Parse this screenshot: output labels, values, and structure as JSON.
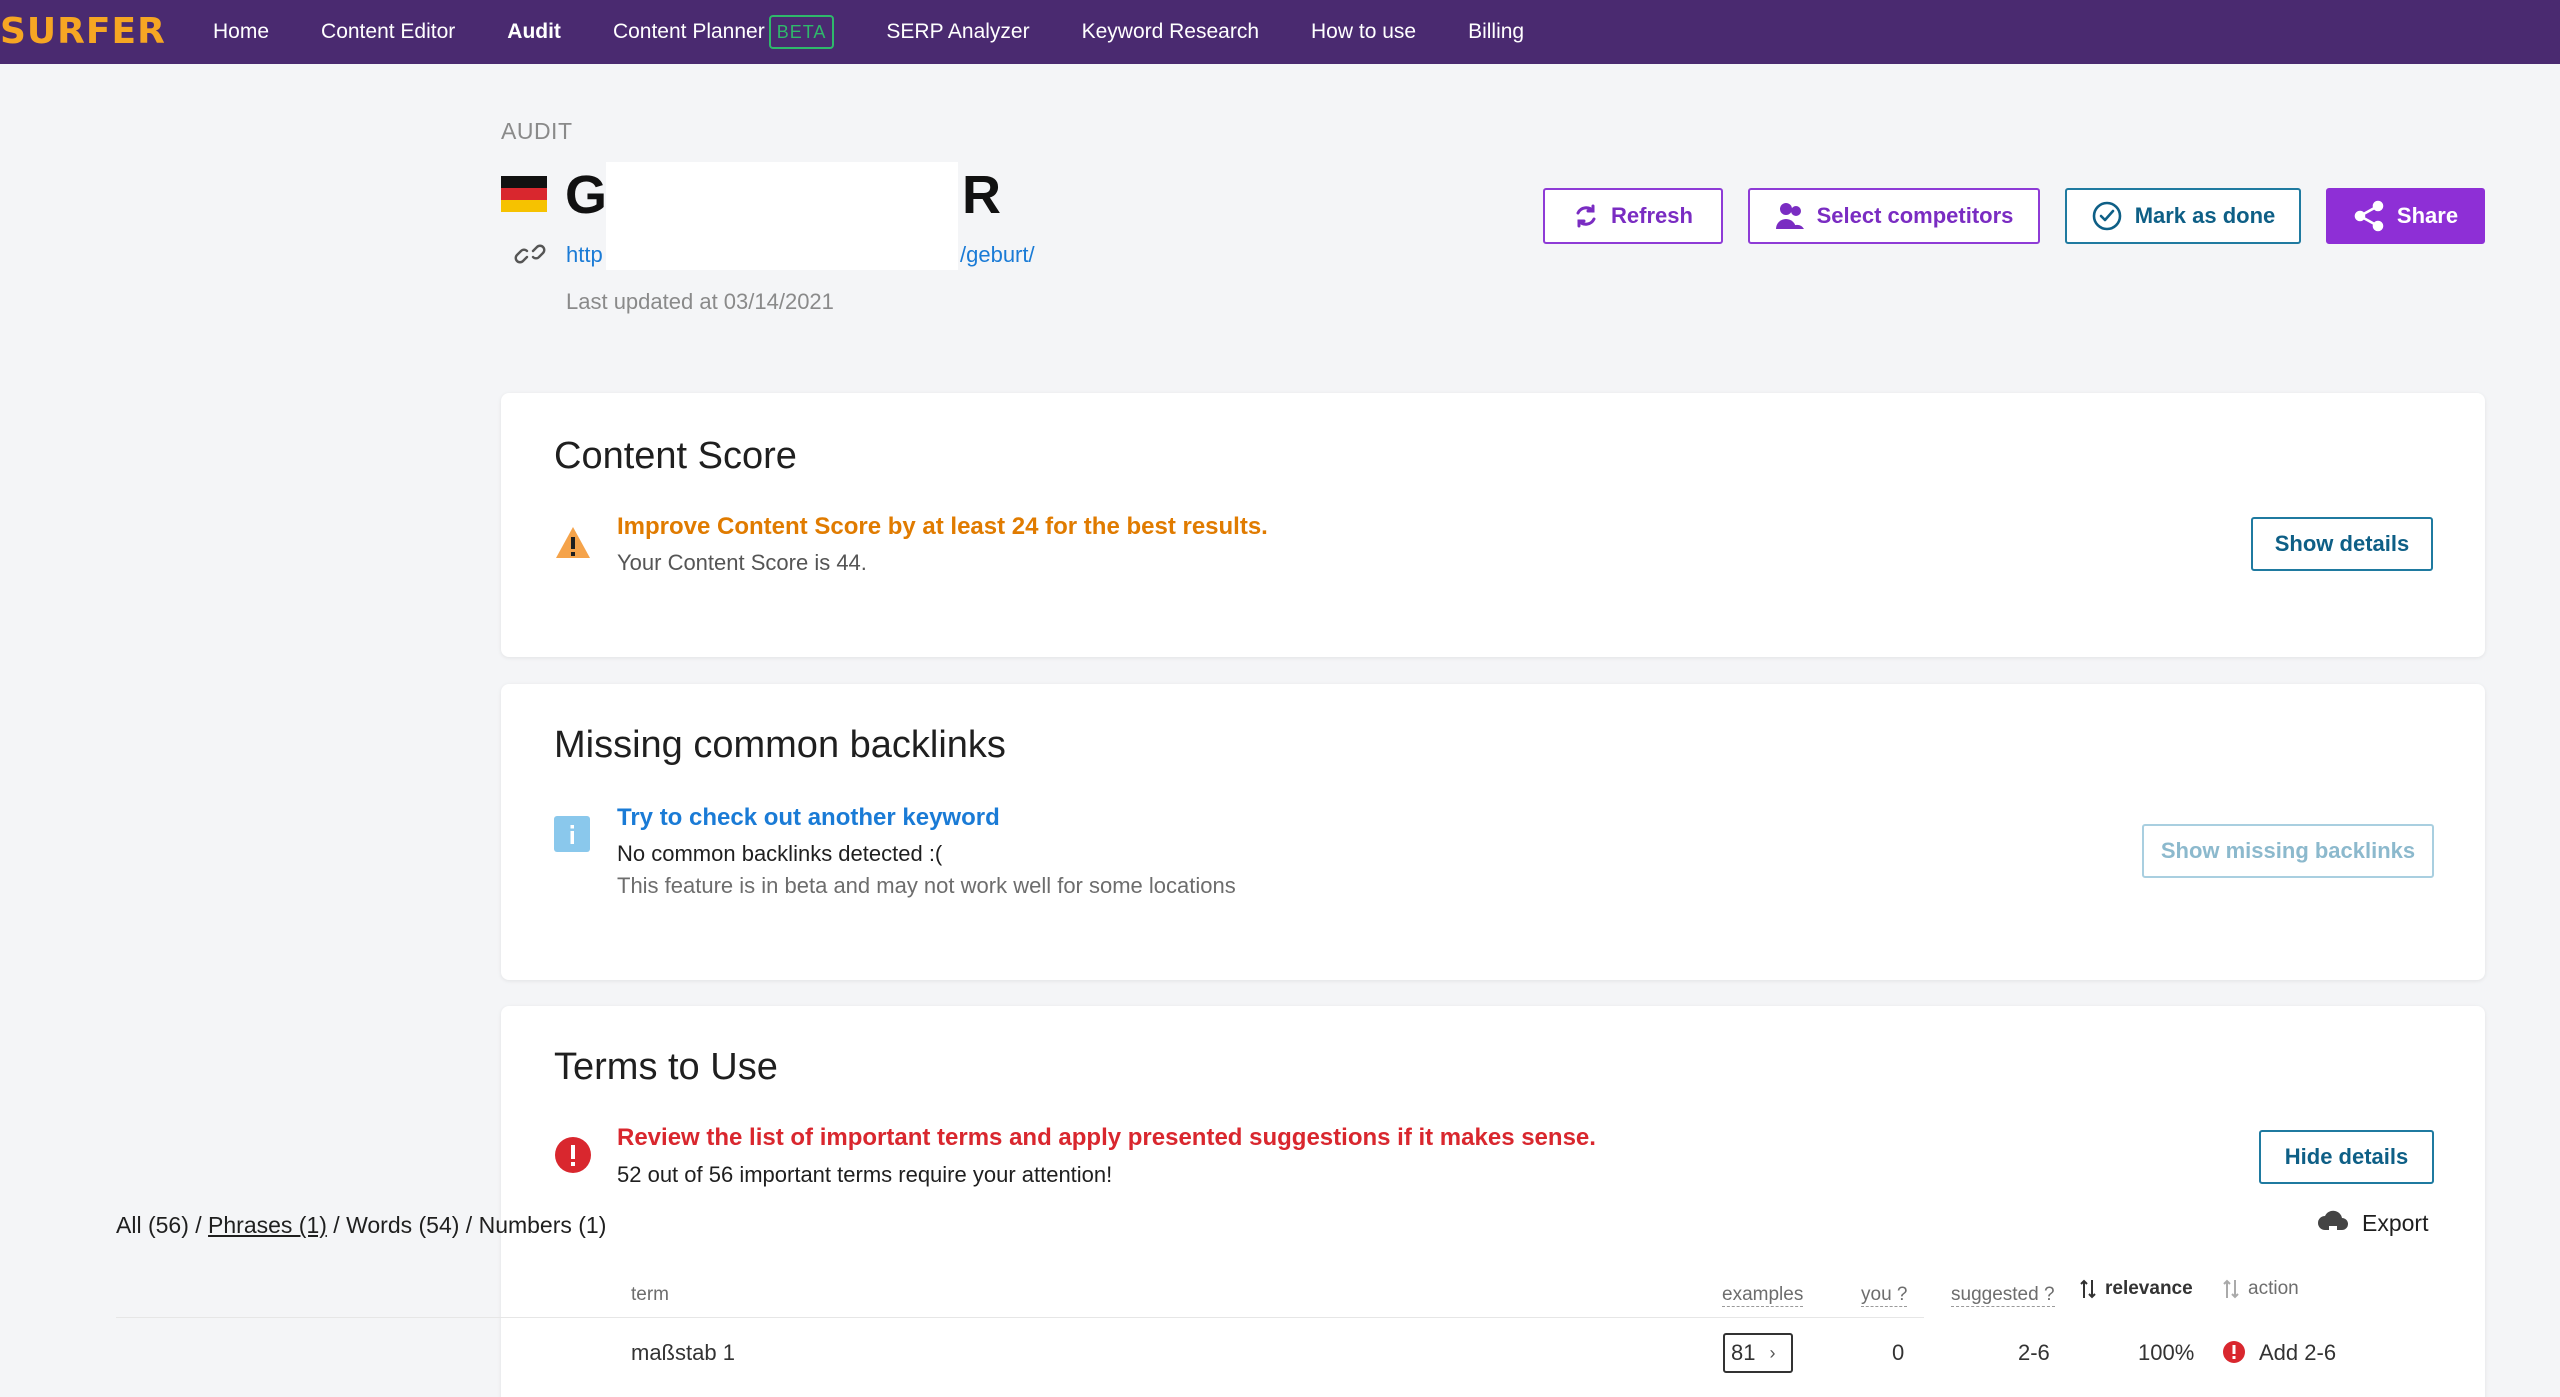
{
  "nav": {
    "logo": "SURFER",
    "items": [
      {
        "label": "Home"
      },
      {
        "label": "Content Editor"
      },
      {
        "label": "Audit"
      },
      {
        "label": "Content Planner",
        "badge": "BETA"
      },
      {
        "label": "SERP Analyzer"
      },
      {
        "label": "Keyword Research"
      },
      {
        "label": "How to use"
      },
      {
        "label": "Billing"
      }
    ]
  },
  "header": {
    "breadcrumb": "AUDIT",
    "title_start": "G",
    "title_end": "R",
    "url_start": "http",
    "url_end": "/geburt/",
    "last_updated": "Last updated at 03/14/2021",
    "buttons": {
      "refresh": "Refresh",
      "select_competitors": "Select competitors",
      "mark_done": "Mark as done",
      "share": "Share"
    }
  },
  "content_score": {
    "title": "Content Score",
    "headline": "Improve Content Score by at least 24 for the best results.",
    "subline": "Your Content Score is 44.",
    "button": "Show details"
  },
  "backlinks": {
    "title": "Missing common backlinks",
    "headline": "Try to check out another keyword",
    "line1": "No common backlinks detected :(",
    "line2": "This feature is in beta and may not work well for some locations",
    "button": "Show missing backlinks"
  },
  "terms": {
    "title": "Terms to Use",
    "headline": "Review the list of important terms and apply presented suggestions if it makes sense.",
    "subline": "52 out of 56 important terms require your attention!",
    "button": "Hide details",
    "filters": {
      "all": "All (56)",
      "phrases": "Phrases (1)",
      "words": "Words (54)",
      "numbers": "Numbers (1)",
      "sep": " / "
    },
    "export": "Export",
    "columns": {
      "term": "term",
      "examples": "examples",
      "you": "you ?",
      "suggested": "suggested ?",
      "relevance": "relevance",
      "action": "action"
    },
    "rows": [
      {
        "term": "maßstab 1",
        "examples": "81",
        "you": "0",
        "suggested": "2-6",
        "relevance": "100%",
        "action": "Add 2-6"
      }
    ]
  },
  "colors": {
    "nav_bg": "#4a2a70",
    "logo": "#f6a623",
    "warning": "#e07b00",
    "info": "#1a7bd6",
    "error": "#d9272e",
    "primary": "#8e2fd6"
  },
  "icons": [
    "germany-flag-icon",
    "link-icon",
    "refresh-icon",
    "users-icon",
    "check-circle-icon",
    "share-icon",
    "warning-icon",
    "info-icon",
    "error-icon",
    "cloud-download-icon",
    "sort-icon"
  ]
}
